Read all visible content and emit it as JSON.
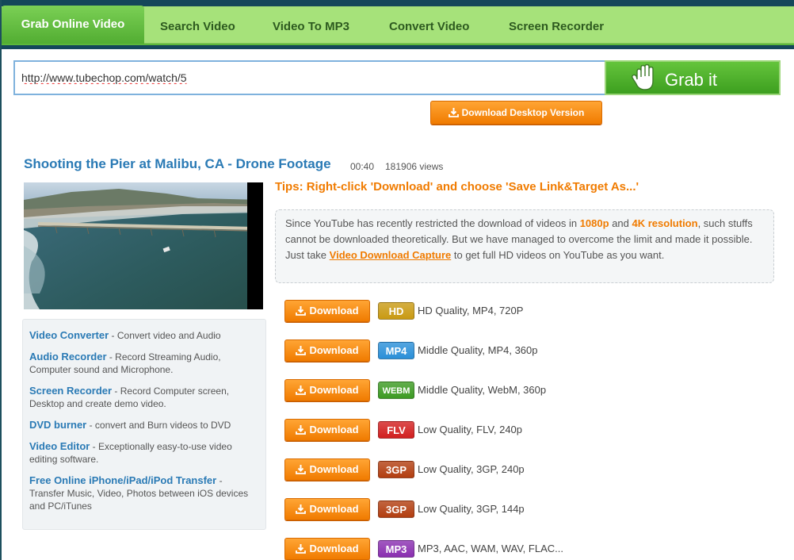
{
  "tabs": [
    {
      "label": "Grab Online Video",
      "active": true
    },
    {
      "label": "Search Video"
    },
    {
      "label": "Video To MP3"
    },
    {
      "label": "Convert Video"
    },
    {
      "label": "Screen Recorder"
    }
  ],
  "url_input": {
    "value": "http://www.tubechop.com/watch/5"
  },
  "grab_button": {
    "label": "Grab it",
    "icon": "hand-icon"
  },
  "desktop_button": {
    "label": "Download Desktop Version",
    "icon": "download-icon"
  },
  "video": {
    "title": "Shooting the Pier at Malibu, CA - Drone Footage",
    "duration": "00:40",
    "views": "181906 views"
  },
  "tips": "Tips: Right-click 'Download' and choose 'Save Link&Target As...'",
  "notice": {
    "p1": "Since YouTube has recently restricted the download of videos in ",
    "hl1": "1080p",
    "and": " and ",
    "hl2": "4K resolution",
    "p2": ", such stuffs cannot be downloaded theoretically. But we have managed to overcome the limit and made it possible. Just take ",
    "link": "Video Download Capture",
    "p3": " to get full HD videos on YouTube as you want."
  },
  "sidebar_links": [
    {
      "title": "Video Converter",
      "desc": " - Convert video and Audio"
    },
    {
      "title": "Audio Recorder",
      "desc": " - Record Streaming Audio, Computer sound and Microphone."
    },
    {
      "title": "Screen Recorder",
      "desc": " - Record Computer screen, Desktop and create demo video."
    },
    {
      "title": "DVD burner",
      "desc": " - convert and Burn videos to DVD"
    },
    {
      "title": "Video Editor",
      "desc": " - Exceptionally easy-to-use video editing software."
    },
    {
      "title": "Free Online iPhone/iPad/iPod Transfer",
      "desc": " - Transfer Music, Video, Photos between iOS devices and PC/iTunes"
    }
  ],
  "download_label": "Download",
  "downloads": [
    {
      "badge": "HD",
      "color": "#c99a13",
      "desc": "HD Quality, MP4, 720P"
    },
    {
      "badge": "MP4",
      "color": "#2a8fd8",
      "desc": "Middle Quality, MP4, 360p"
    },
    {
      "badge": "WEBM",
      "color": "#3c9a22",
      "desc": "Middle Quality, WebM, 360p"
    },
    {
      "badge": "FLV",
      "color": "#d21f1f",
      "desc": "Low Quality, FLV, 240p"
    },
    {
      "badge": "3GP",
      "color": "#b23e10",
      "desc": "Low Quality, 3GP, 240p"
    },
    {
      "badge": "3GP",
      "color": "#b23e10",
      "desc": "Low Quality, 3GP, 144p"
    },
    {
      "badge": "MP3",
      "color": "#8a2fb0",
      "desc": "MP3, AAC, WAM, WAV, FLAC..."
    }
  ],
  "colors": {
    "accent_green": "#52ad32",
    "accent_orange": "#f07b00",
    "link_blue": "#2a7ab5"
  }
}
